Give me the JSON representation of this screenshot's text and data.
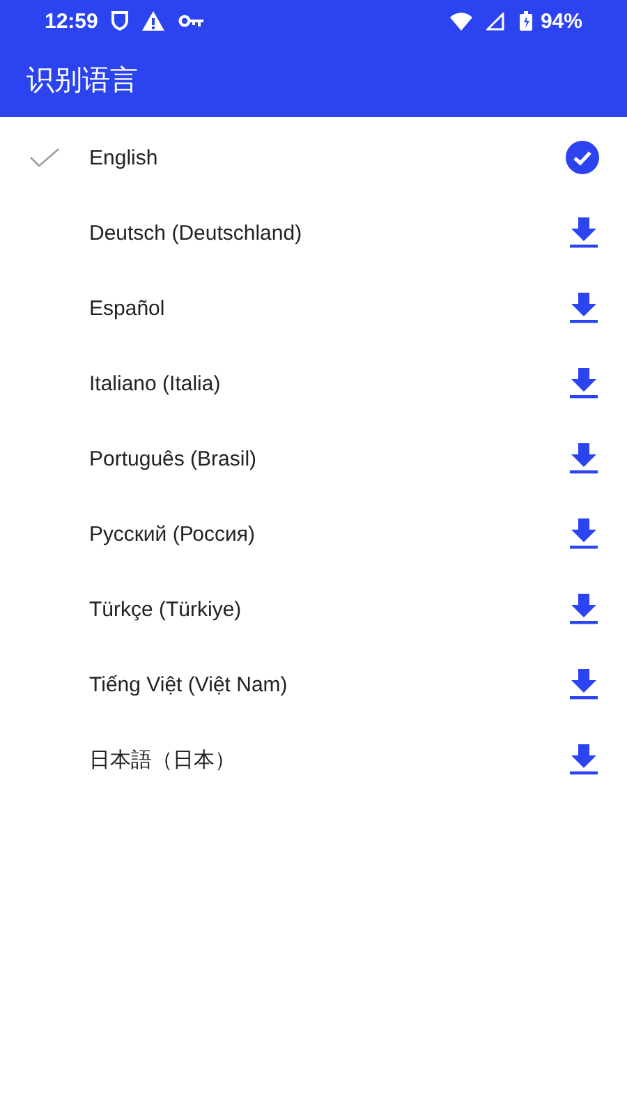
{
  "status_bar": {
    "time": "12:59",
    "battery": "94%"
  },
  "app_bar": {
    "title": "识别语言"
  },
  "languages": [
    {
      "name": "English",
      "selected": true,
      "downloaded": true
    },
    {
      "name": "Deutsch (Deutschland)",
      "selected": false,
      "downloaded": false
    },
    {
      "name": "Español",
      "selected": false,
      "downloaded": false
    },
    {
      "name": "Italiano (Italia)",
      "selected": false,
      "downloaded": false
    },
    {
      "name": "Português (Brasil)",
      "selected": false,
      "downloaded": false
    },
    {
      "name": "Русский (Россия)",
      "selected": false,
      "downloaded": false
    },
    {
      "name": "Türkçe (Türkiye)",
      "selected": false,
      "downloaded": false
    },
    {
      "name": "Tiếng Việt (Việt Nam)",
      "selected": false,
      "downloaded": false
    },
    {
      "name": "日本語（日本）",
      "selected": false,
      "downloaded": false
    }
  ]
}
